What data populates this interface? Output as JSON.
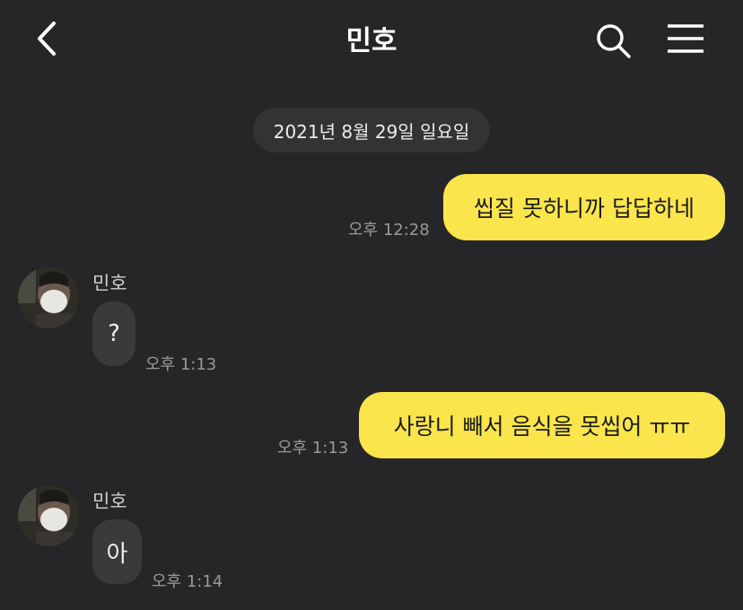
{
  "header": {
    "title": "민호",
    "back_icon": "chevron-left-icon",
    "search_icon": "search-icon",
    "menu_icon": "hamburger-menu-icon"
  },
  "date_divider": "2021년 8월 29일 일요일",
  "messages": [
    {
      "from": "me",
      "text": "씹질 못하니까 답답하네",
      "time": "오후 12:28"
    },
    {
      "from": "other",
      "sender": "민호",
      "text": "?",
      "time": "오후 1:13"
    },
    {
      "from": "me",
      "text": "사랑니 빼서 음식을 못씹어 ㅠㅠ",
      "time": "오후 1:13"
    },
    {
      "from": "other",
      "sender": "민호",
      "text": "아",
      "time": "오후 1:14"
    }
  ],
  "colors": {
    "background": "#262629",
    "my_bubble": "#fae54c",
    "other_bubble": "#3a3a3d",
    "timestamp": "#9a9a9e"
  }
}
